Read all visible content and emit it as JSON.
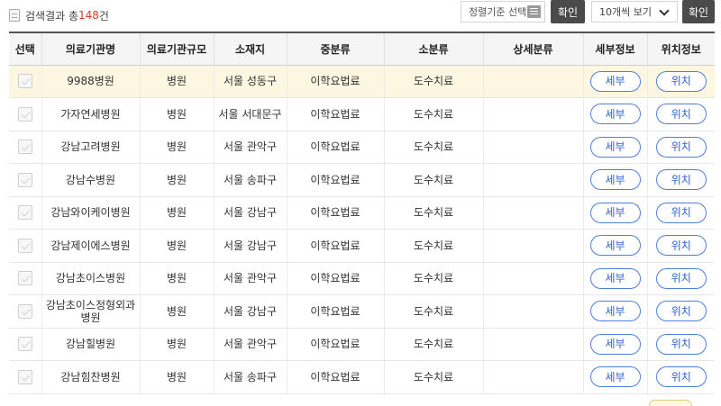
{
  "result": {
    "label": "검색결과 총",
    "count": "148",
    "suffix": "건",
    "icon": "document-icon"
  },
  "sort": {
    "label": "정렬기준 선택",
    "icon": "list-icon",
    "confirm_label": "확인"
  },
  "page_size": {
    "selected": "10개씩 보기",
    "icon": "chevron-down-icon",
    "confirm_label": "확인"
  },
  "colors": {
    "accent": "#2e63d6",
    "count": "#e5322d",
    "highlight": "#fdf7e2",
    "dark_button": "#4a4a4a"
  },
  "table": {
    "headers": [
      "선택",
      "의료기관명",
      "의료기관규모",
      "소재지",
      "중분류",
      "소분류",
      "상세분류",
      "세부정보",
      "위치정보"
    ],
    "detail_button": "세부",
    "location_button": "위치",
    "rows": [
      {
        "name": "9988병원",
        "size": "병원",
        "location": "서울 성동구",
        "mid": "이학요법료",
        "sub": "도수치료",
        "detail": ""
      },
      {
        "name": "가자연세병원",
        "size": "병원",
        "location": "서울 서대문구",
        "mid": "이학요법료",
        "sub": "도수치료",
        "detail": ""
      },
      {
        "name": "강남고려병원",
        "size": "병원",
        "location": "서울 관악구",
        "mid": "이학요법료",
        "sub": "도수치료",
        "detail": ""
      },
      {
        "name": "강남수병원",
        "size": "병원",
        "location": "서울 송파구",
        "mid": "이학요법료",
        "sub": "도수치료",
        "detail": ""
      },
      {
        "name": "강남와이케이병원",
        "size": "병원",
        "location": "서울 강남구",
        "mid": "이학요법료",
        "sub": "도수치료",
        "detail": ""
      },
      {
        "name": "강남제이에스병원",
        "size": "병원",
        "location": "서울 강남구",
        "mid": "이학요법료",
        "sub": "도수치료",
        "detail": ""
      },
      {
        "name": "강남초이스병원",
        "size": "병원",
        "location": "서울 관악구",
        "mid": "이학요법료",
        "sub": "도수치료",
        "detail": ""
      },
      {
        "name": "강남초이스정형외과병원",
        "size": "병원",
        "location": "서울 강남구",
        "mid": "이학요법료",
        "sub": "도수치료",
        "detail": ""
      },
      {
        "name": "강남힐병원",
        "size": "병원",
        "location": "서울 관악구",
        "mid": "이학요법료",
        "sub": "도수치료",
        "detail": ""
      },
      {
        "name": "강남힘찬병원",
        "size": "병원",
        "location": "서울 송파구",
        "mid": "이학요법료",
        "sub": "도수치료",
        "detail": ""
      }
    ]
  }
}
